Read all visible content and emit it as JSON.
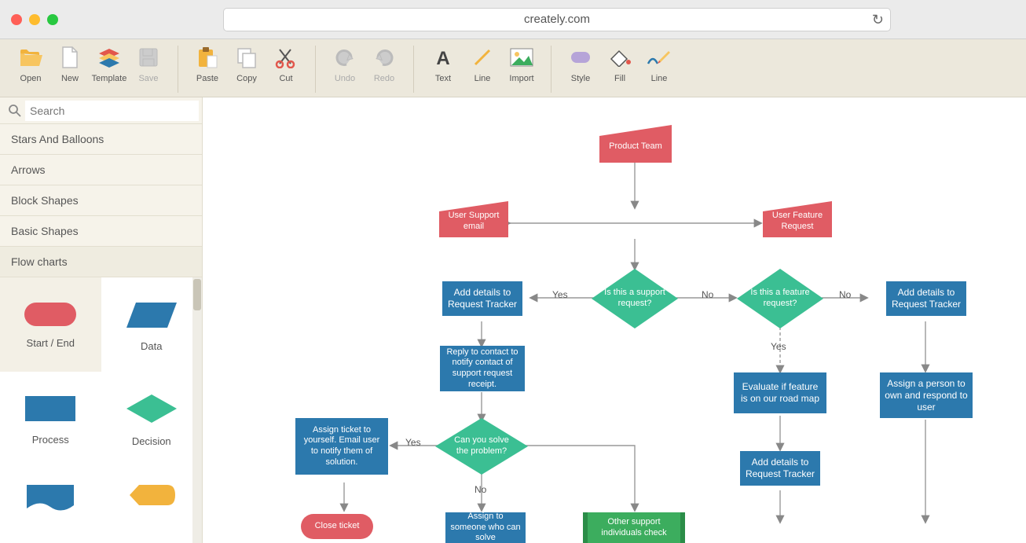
{
  "browser": {
    "url": "creately.com"
  },
  "toolbar": {
    "groups": [
      [
        {
          "id": "open",
          "label": "Open"
        },
        {
          "id": "new",
          "label": "New"
        },
        {
          "id": "template",
          "label": "Template"
        },
        {
          "id": "save",
          "label": "Save",
          "disabled": true
        }
      ],
      [
        {
          "id": "paste",
          "label": "Paste"
        },
        {
          "id": "copy",
          "label": "Copy"
        },
        {
          "id": "cut",
          "label": "Cut"
        }
      ],
      [
        {
          "id": "undo",
          "label": "Undo",
          "disabled": true
        },
        {
          "id": "redo",
          "label": "Redo",
          "disabled": true
        }
      ],
      [
        {
          "id": "text",
          "label": "Text"
        },
        {
          "id": "connect_line",
          "label": "Line"
        },
        {
          "id": "import",
          "label": "Import"
        }
      ],
      [
        {
          "id": "style",
          "label": "Style"
        },
        {
          "id": "fill",
          "label": "Fill"
        },
        {
          "id": "line",
          "label": "Line"
        }
      ]
    ]
  },
  "sidebar": {
    "search_placeholder": "Search",
    "categories": [
      {
        "label": "Stars And Balloons"
      },
      {
        "label": "Arrows"
      },
      {
        "label": "Block Shapes"
      },
      {
        "label": "Basic Shapes"
      },
      {
        "label": "Flow charts",
        "active": true
      }
    ],
    "palette": [
      {
        "label": "Start / End",
        "shape": "terminator",
        "selected": true
      },
      {
        "label": "Data",
        "shape": "data"
      },
      {
        "label": "Process",
        "shape": "process"
      },
      {
        "label": "Decision",
        "shape": "decision"
      },
      {
        "label": "",
        "shape": "document"
      },
      {
        "label": "",
        "shape": "display"
      }
    ]
  },
  "canvas": {
    "nodes": {
      "n0": {
        "label": "Product Team"
      },
      "n1": {
        "label": "User Support email"
      },
      "n2": {
        "label": "User Feature Request"
      },
      "d1": {
        "label": "Is this a support request?"
      },
      "d2": {
        "label": "Is this a feature request?"
      },
      "p1": {
        "label": "Add details to Request Tracker"
      },
      "p2": {
        "label": "Add details to Request Tracker"
      },
      "p3": {
        "label": "Reply to contact to notify contact of support request receipt."
      },
      "p4": {
        "label": "Evaluate if feature is on our road map"
      },
      "p5": {
        "label": "Assign a person to own and respond to user"
      },
      "d3": {
        "label": "Can you solve the problem?"
      },
      "p6": {
        "label": "Assign ticket to yourself. Email user to notify them of solution."
      },
      "p7": {
        "label": "Add details to Request Tracker"
      },
      "p8": {
        "label": "Assign to someone who can solve"
      },
      "s1": {
        "label": "Other support individuals check"
      },
      "t1": {
        "label": "Close ticket"
      }
    },
    "edge_labels": {
      "e1": "Yes",
      "e2": "No",
      "e3": "No",
      "e4": "Yes",
      "e5": "Yes",
      "e6": "No"
    }
  }
}
